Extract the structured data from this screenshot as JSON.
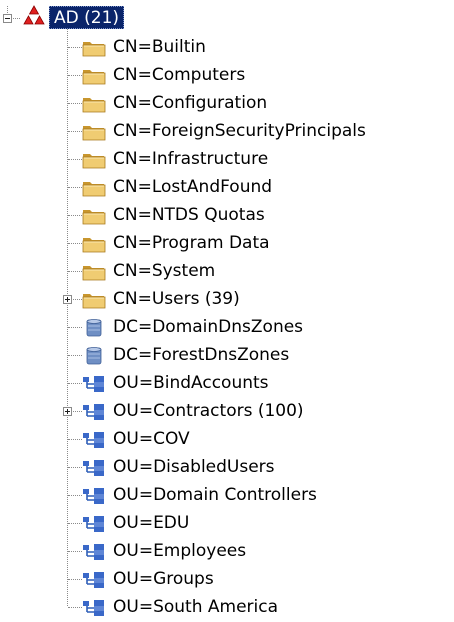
{
  "colors": {
    "selection": "#0a246a",
    "folder": "#e6c06a",
    "ou_icon": "#3a68c8",
    "root_icon": "#e02020"
  },
  "root": {
    "label": "AD (21)",
    "icon": "ad-domain-icon",
    "state": "expanded"
  },
  "items": [
    {
      "label": "CN=Builtin",
      "icon": "folder-icon",
      "expandable": false
    },
    {
      "label": "CN=Computers",
      "icon": "folder-icon",
      "expandable": false
    },
    {
      "label": "CN=Configuration",
      "icon": "folder-icon",
      "expandable": false
    },
    {
      "label": "CN=ForeignSecurityPrincipals",
      "icon": "folder-icon",
      "expandable": false
    },
    {
      "label": "CN=Infrastructure",
      "icon": "folder-icon",
      "expandable": false
    },
    {
      "label": "CN=LostAndFound",
      "icon": "folder-icon",
      "expandable": false
    },
    {
      "label": "CN=NTDS Quotas",
      "icon": "folder-icon",
      "expandable": false
    },
    {
      "label": "CN=Program Data",
      "icon": "folder-icon",
      "expandable": false
    },
    {
      "label": "CN=System",
      "icon": "folder-icon",
      "expandable": false
    },
    {
      "label": "CN=Users (39)",
      "icon": "folder-icon",
      "expandable": true
    },
    {
      "label": "DC=DomainDnsZones",
      "icon": "database-icon",
      "expandable": false
    },
    {
      "label": "DC=ForestDnsZones",
      "icon": "database-icon",
      "expandable": false
    },
    {
      "label": "OU=BindAccounts",
      "icon": "org-unit-icon",
      "expandable": false
    },
    {
      "label": "OU=Contractors (100)",
      "icon": "org-unit-icon",
      "expandable": true
    },
    {
      "label": "OU=COV",
      "icon": "org-unit-icon",
      "expandable": false
    },
    {
      "label": "OU=DisabledUsers",
      "icon": "org-unit-icon",
      "expandable": false
    },
    {
      "label": "OU=Domain Controllers",
      "icon": "org-unit-icon",
      "expandable": false
    },
    {
      "label": "OU=EDU",
      "icon": "org-unit-icon",
      "expandable": false
    },
    {
      "label": "OU=Employees",
      "icon": "org-unit-icon",
      "expandable": false
    },
    {
      "label": "OU=Groups",
      "icon": "org-unit-icon",
      "expandable": false
    },
    {
      "label": "OU=South America",
      "icon": "org-unit-icon",
      "expandable": false
    }
  ]
}
